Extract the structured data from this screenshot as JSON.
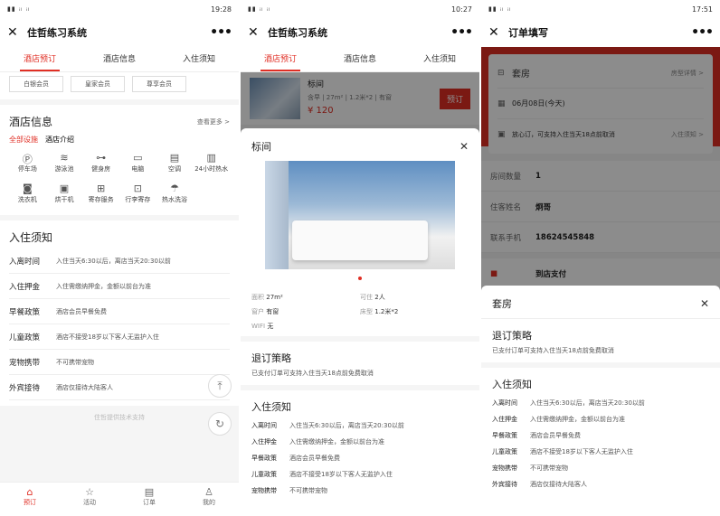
{
  "colors": {
    "accent": "#e02e24"
  },
  "screen1": {
    "status_time": "19:28",
    "title": "住哲练习系统",
    "tabs": [
      "酒店预订",
      "酒店信息",
      "入住须知"
    ],
    "members": [
      "白银会员",
      "皇家会员",
      "尊享会员"
    ],
    "hotel_info_title": "酒店信息",
    "see_more": "查看更多 >",
    "subtabs": [
      "全部设施",
      "酒店介绍"
    ],
    "facilities": [
      {
        "icon": "parking-icon",
        "glyph": "Ⓟ",
        "label": "停车场"
      },
      {
        "icon": "pool-icon",
        "glyph": "≋",
        "label": "游泳池"
      },
      {
        "icon": "gym-icon",
        "glyph": "⊶",
        "label": "健身房"
      },
      {
        "icon": "computer-icon",
        "glyph": "▭",
        "label": "电脑"
      },
      {
        "icon": "aircon-icon",
        "glyph": "▤",
        "label": "空调"
      },
      {
        "icon": "hotwater-icon",
        "glyph": "▥",
        "label": "24小时热水"
      },
      {
        "icon": "washer-icon",
        "glyph": "◙",
        "label": "洗衣机"
      },
      {
        "icon": "dryer-icon",
        "glyph": "▣",
        "label": "烘干机"
      },
      {
        "icon": "storage-icon",
        "glyph": "⊞",
        "label": "寄存服务"
      },
      {
        "icon": "luggage-icon",
        "glyph": "⊡",
        "label": "行李寄存"
      },
      {
        "icon": "shower-icon",
        "glyph": "☂",
        "label": "热水洗浴"
      }
    ],
    "notice_title": "入住须知",
    "rules": [
      {
        "k": "入离时间",
        "v": "入住当天6:30以后，离店当天20:30以前"
      },
      {
        "k": "入住押金",
        "v": "入住需缴纳押金，金额以前台为准"
      },
      {
        "k": "早餐政策",
        "v": "酒店会员早餐免费"
      },
      {
        "k": "儿童政策",
        "v": "酒店不接受18岁以下客人无监护入住"
      },
      {
        "k": "宠物携带",
        "v": "不可携带宠物"
      },
      {
        "k": "外宾接待",
        "v": "酒店仅接待大陆客人"
      }
    ],
    "support_note": "住哲提供技术支持",
    "nav": [
      {
        "icon": "home-icon",
        "glyph": "⌂",
        "label": "预订"
      },
      {
        "icon": "star-icon",
        "glyph": "☆",
        "label": "活动"
      },
      {
        "icon": "order-icon",
        "glyph": "▤",
        "label": "订单"
      },
      {
        "icon": "user-icon",
        "glyph": "♙",
        "label": "我的"
      }
    ]
  },
  "screen2": {
    "status_time": "10:27",
    "title": "住哲练习系统",
    "tabs": [
      "酒店预订",
      "酒店信息",
      "入住须知"
    ],
    "room_name": "标间",
    "room_meta": "含早 | 27m² | 1.2米*2 | 有窗",
    "room_price": "¥ 120",
    "book_label": "预订",
    "sheet_title": "标间",
    "attrs": [
      {
        "k": "面积",
        "v": "27m²"
      },
      {
        "k": "可住",
        "v": "2人"
      },
      {
        "k": "窗户",
        "v": "有窗"
      },
      {
        "k": "床型",
        "v": "1.2米*2"
      },
      {
        "k": "WIFI",
        "v": "无"
      }
    ],
    "policy_title": "退订策略",
    "policy_text": "已支付订单可支持入住当天18点前免费取消",
    "notice_title": "入住须知",
    "rules": [
      {
        "k": "入离时间",
        "v": "入住当天6:30以后，离店当天20:30以前"
      },
      {
        "k": "入住押金",
        "v": "入住需缴纳押金，金额以前台为准"
      },
      {
        "k": "早餐政策",
        "v": "酒店会员早餐免费"
      },
      {
        "k": "儿童政策",
        "v": "酒店不接受18岁以下客人无监护入住"
      },
      {
        "k": "宠物携带",
        "v": "不可携带宠物"
      }
    ]
  },
  "screen3": {
    "status_time": "17:51",
    "title": "订单填写",
    "room_type": "套房",
    "room_detail_link": "房型详情 >",
    "date": "06月08日(今天)",
    "cancel_note": "放心订，可支持入住当天18点前取消",
    "notice_link": "入住须知 >",
    "fields": [
      {
        "k": "房间数量",
        "v": "1"
      },
      {
        "k": "住客姓名",
        "v": "炯哥"
      },
      {
        "k": "联系手机",
        "v": "18624545848"
      }
    ],
    "pay_label": "到店支付",
    "sheet_title": "套房",
    "policy_title": "退订策略",
    "policy_text": "已支付订单可支持入住当天18点前免费取消",
    "notice_title": "入住须知",
    "rules": [
      {
        "k": "入离时间",
        "v": "入住当天6:30以后，离店当天20:30以前"
      },
      {
        "k": "入住押金",
        "v": "入住需缴纳押金，金额以前台为准"
      },
      {
        "k": "早餐政策",
        "v": "酒店会员早餐免费"
      },
      {
        "k": "儿童政策",
        "v": "酒店不接受18岁以下客人无监护入住"
      },
      {
        "k": "宠物携带",
        "v": "不可携带宠物"
      },
      {
        "k": "外宾接待",
        "v": "酒店仅接待大陆客人"
      }
    ]
  }
}
